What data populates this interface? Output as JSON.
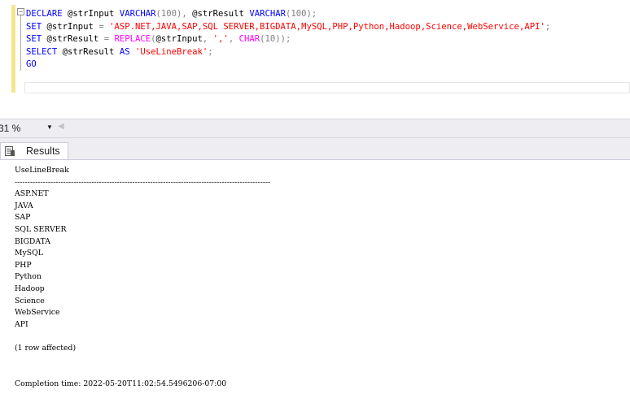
{
  "editor": {
    "fold_symbol": "−",
    "lines": [
      {
        "parts": [
          {
            "t": "DECLARE",
            "c": "kw"
          },
          {
            "t": " @strInput ",
            "c": ""
          },
          {
            "t": "VARCHAR",
            "c": "kw"
          },
          {
            "t": "(100), ",
            "c": "gray"
          },
          {
            "t": "@strResult ",
            "c": ""
          },
          {
            "t": "VARCHAR",
            "c": "kw"
          },
          {
            "t": "(100);",
            "c": "gray"
          }
        ]
      },
      {
        "parts": [
          {
            "t": "SET",
            "c": "kw"
          },
          {
            "t": " @strInput ",
            "c": ""
          },
          {
            "t": "= ",
            "c": "gray"
          },
          {
            "t": "'ASP.NET,JAVA,SAP,SQL SERVER,BIGDATA,MySQL,PHP,Python,Hadoop,Science,WebService,API'",
            "c": "str"
          },
          {
            "t": ";",
            "c": "gray"
          }
        ]
      },
      {
        "parts": [
          {
            "t": "SET",
            "c": "kw"
          },
          {
            "t": " @strResult ",
            "c": ""
          },
          {
            "t": "= ",
            "c": "gray"
          },
          {
            "t": "REPLACE",
            "c": "fn"
          },
          {
            "t": "(",
            "c": "gray"
          },
          {
            "t": "@strInput",
            "c": ""
          },
          {
            "t": ", ",
            "c": "gray"
          },
          {
            "t": "','",
            "c": "str"
          },
          {
            "t": ", ",
            "c": "gray"
          },
          {
            "t": "CHAR",
            "c": "fn"
          },
          {
            "t": "(10));",
            "c": "gray"
          }
        ]
      },
      {
        "parts": [
          {
            "t": "SELECT",
            "c": "kw"
          },
          {
            "t": " @strResult ",
            "c": ""
          },
          {
            "t": "AS",
            "c": "kw"
          },
          {
            "t": " ",
            "c": ""
          },
          {
            "t": "'UseLineBreak'",
            "c": "str"
          },
          {
            "t": ";",
            "c": "gray"
          }
        ]
      },
      {
        "parts": [
          {
            "t": "GO",
            "c": "kw"
          }
        ]
      }
    ]
  },
  "status_bar": {
    "zoom": "31 %",
    "zoom_dropdown_icon": "chevron-down-icon",
    "scroll_icon": "scroll-left-icon"
  },
  "results": {
    "tab_label": "Results",
    "tab_icon": "results-grid-icon",
    "column_header": "UseLineBreak",
    "separator": "----------------------------------------------------------------------------------------------------",
    "values": [
      "ASP.NET",
      "JAVA",
      "SAP",
      "SQL SERVER",
      "BIGDATA",
      "MySQL",
      "PHP",
      "Python",
      "Hadoop",
      "Science",
      "WebService",
      "API"
    ],
    "rows_affected": "(1 row affected)",
    "completion": "Completion time: 2022-05-20T11:02:54.5496206-07:00"
  },
  "colors": {
    "keyword": "#0000ff",
    "string": "#ff0000",
    "function": "#ff00ff",
    "operator": "#808080",
    "change_bar": "#f3e68b",
    "status_bar_bg": "#eeeef2"
  }
}
